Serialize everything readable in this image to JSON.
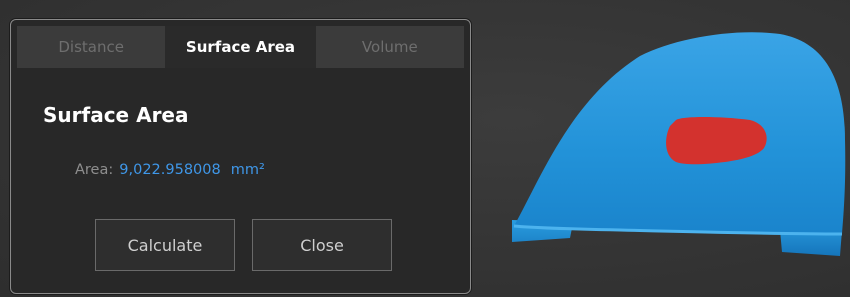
{
  "tabs": [
    {
      "label": "Distance",
      "active": false
    },
    {
      "label": "Surface Area",
      "active": true
    },
    {
      "label": "Volume",
      "active": false
    }
  ],
  "panel": {
    "title": "Surface Area",
    "area_label": "Area:",
    "area_value": "9,022.958008",
    "area_unit": "mm²"
  },
  "buttons": {
    "calculate_label": "Calculate",
    "close_label": "Close"
  },
  "colors": {
    "accent": "#3f97e8",
    "model_surface": "#1f8fd6",
    "selected_region": "#d3322e",
    "background": "#363636"
  }
}
